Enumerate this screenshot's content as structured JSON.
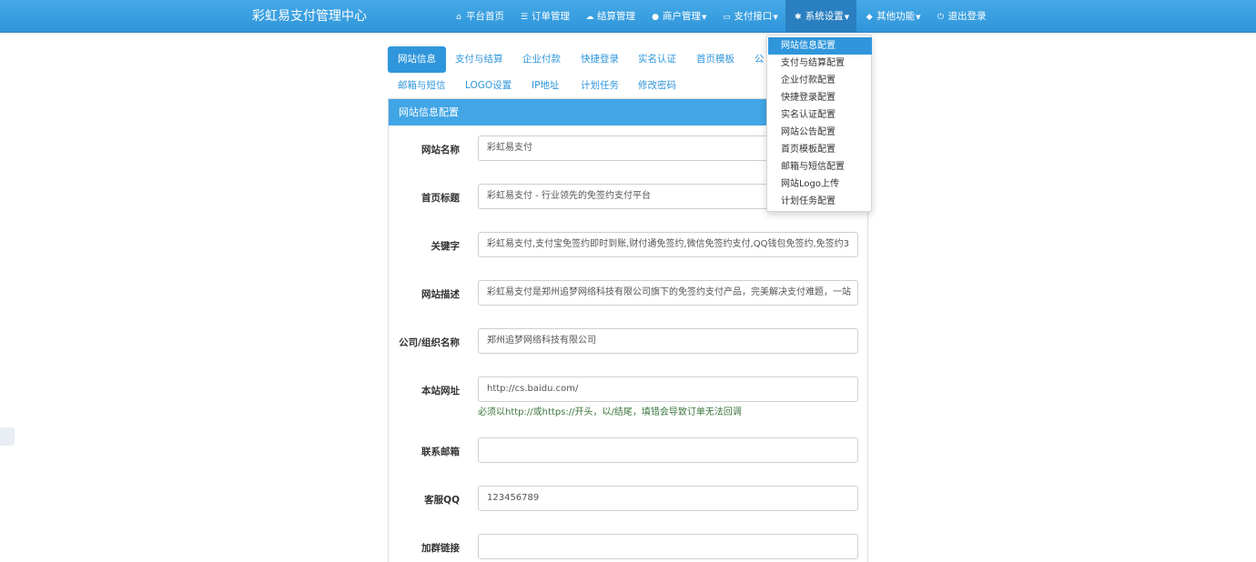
{
  "brand": "彩虹易支付管理中心",
  "nav": [
    {
      "icon": "home-icon",
      "glyph": "⌂",
      "label": "平台首页",
      "caret": false
    },
    {
      "icon": "list-icon",
      "glyph": "☰",
      "label": "订单管理",
      "caret": false
    },
    {
      "icon": "cloud-icon",
      "glyph": "☁",
      "label": "结算管理",
      "caret": false
    },
    {
      "icon": "user-icon",
      "glyph": "●",
      "label": "商户管理",
      "caret": true
    },
    {
      "icon": "credit-card-icon",
      "glyph": "▭",
      "label": "支付接口",
      "caret": true
    },
    {
      "icon": "gear-icon",
      "glyph": "✱",
      "label": "系统设置",
      "caret": true,
      "active": true
    },
    {
      "icon": "cube-icon",
      "glyph": "◆",
      "label": "其他功能",
      "caret": true
    },
    {
      "icon": "power-icon",
      "glyph": "⏻",
      "label": "退出登录",
      "caret": false
    }
  ],
  "tabs_row1": [
    "网站信息",
    "支付与结算",
    "企业付款",
    "快捷登录",
    "实名认证",
    "首页模板",
    "公"
  ],
  "tabs_row2": [
    "邮箱与短信",
    "LOGO设置",
    "IP地址",
    "计划任务",
    "修改密码"
  ],
  "panel": {
    "title": "网站信息配置",
    "fields": [
      {
        "label": "网站名称",
        "value": "彩虹易支付"
      },
      {
        "label": "首页标题",
        "value": "彩虹易支付 - 行业领先的免签约支付平台"
      },
      {
        "label": "关键字",
        "value": "彩虹易支付,支付宝免签约即时到账,财付通免签约,微信免签约支付,QQ钱包免签约,免签约3"
      },
      {
        "label": "网站描述",
        "value": "彩虹易支付是郑州追梦网络科技有限公司旗下的免签约支付产品，完美解决支付难题，一站"
      },
      {
        "label": "公司/组织名称",
        "value": "郑州追梦网络科技有限公司"
      },
      {
        "label": "本站网址",
        "value": "http://cs.baidu.com/",
        "help": "必须以http://或https://开头，以/结尾，填错会导致订单无法回调"
      },
      {
        "label": "联系邮箱",
        "value": ""
      },
      {
        "label": "客服QQ",
        "value": "123456789"
      },
      {
        "label": "加群链接",
        "value": ""
      }
    ]
  },
  "dropdown": [
    "网站信息配置",
    "支付与结算配置",
    "企业付款配置",
    "快捷登录配置",
    "实名认证配置",
    "网站公告配置",
    "首页模板配置",
    "邮箱与短信配置",
    "网站Logo上传",
    "计划任务配置"
  ],
  "colors": {
    "accent": "#2f96db",
    "help": "#3c763d"
  }
}
